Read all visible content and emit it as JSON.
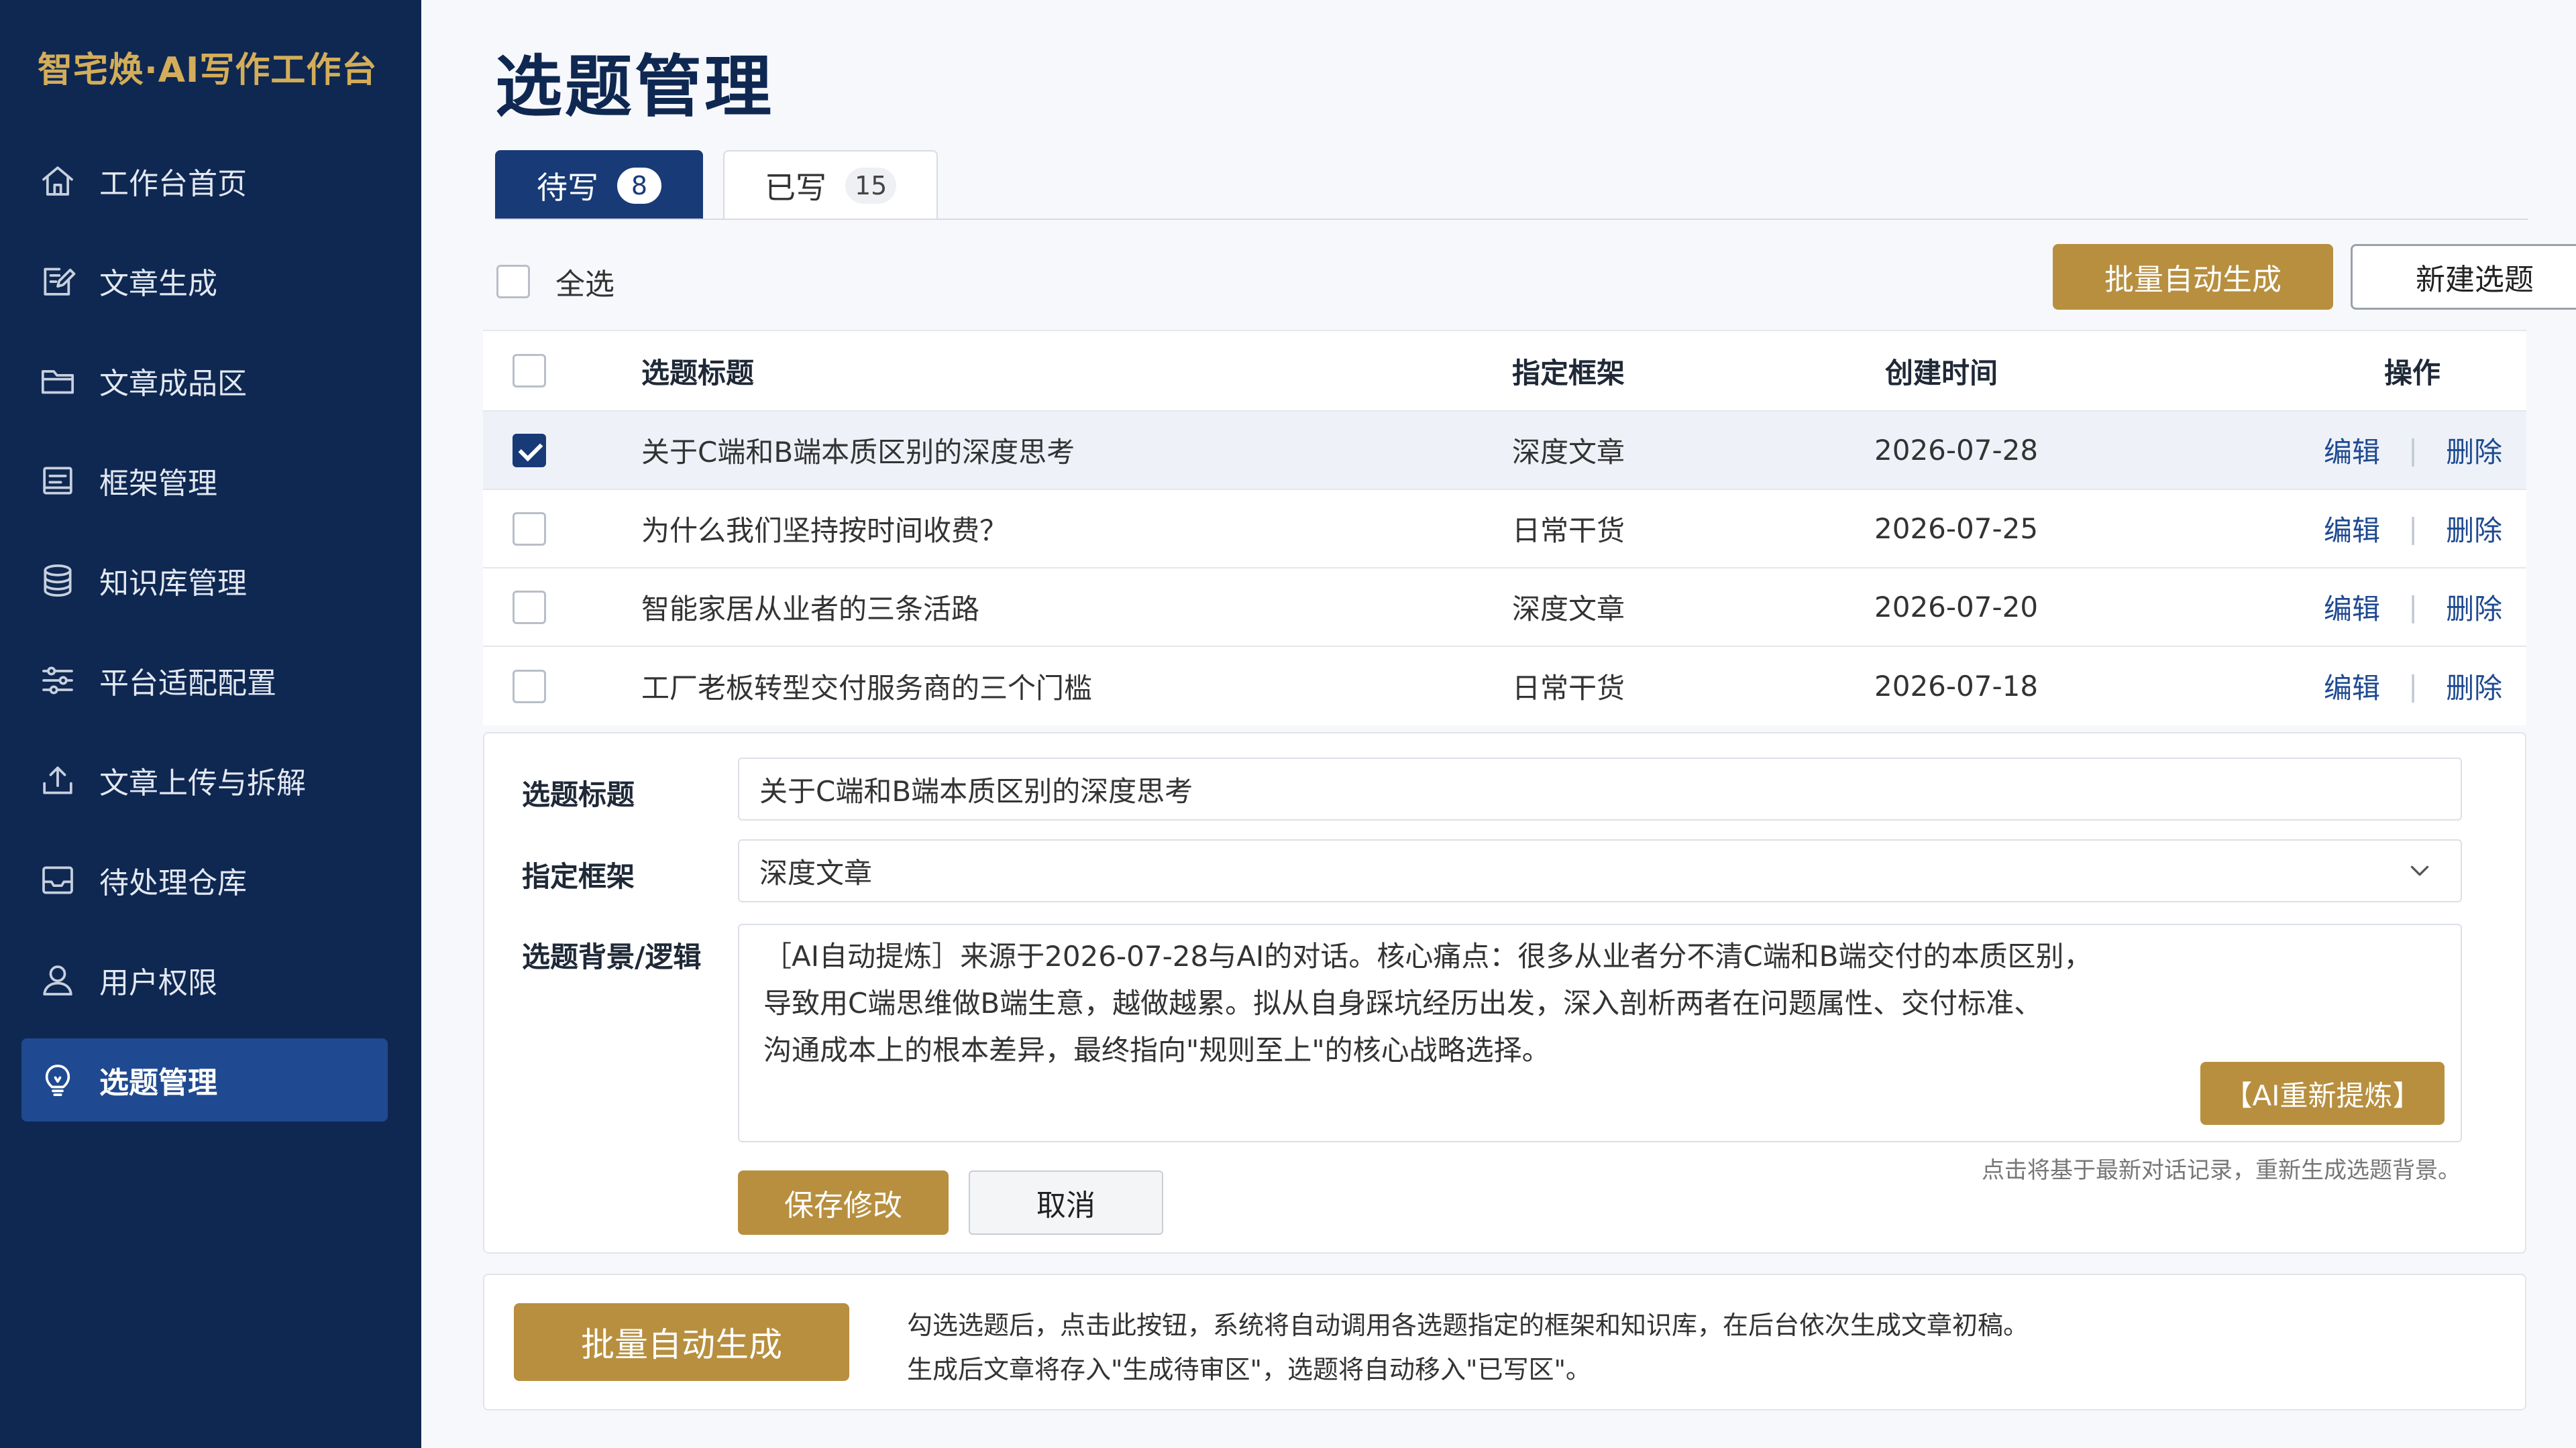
{
  "sidebar": {
    "brand": "智宅焕·AI写作工作台",
    "items": [
      {
        "label": "工作台首页",
        "icon": "home-icon"
      },
      {
        "label": "文章生成",
        "icon": "edit-icon"
      },
      {
        "label": "文章成品区",
        "icon": "folder-icon"
      },
      {
        "label": "框架管理",
        "icon": "frame-icon"
      },
      {
        "label": "知识库管理",
        "icon": "database-icon"
      },
      {
        "label": "平台适配配置",
        "icon": "sliders-icon"
      },
      {
        "label": "文章上传与拆解",
        "icon": "upload-icon"
      },
      {
        "label": "待处理仓库",
        "icon": "inbox-icon"
      },
      {
        "label": "用户权限",
        "icon": "user-icon"
      },
      {
        "label": "选题管理",
        "icon": "lightbulb-icon",
        "active": true
      }
    ]
  },
  "page": {
    "title": "选题管理"
  },
  "tabs": [
    {
      "label": "待写",
      "count": "8",
      "active": true
    },
    {
      "label": "已写",
      "count": "15",
      "active": false
    }
  ],
  "toolbar": {
    "select_all": "全选",
    "batch_generate": "批量自动生成",
    "new_topic": "新建选题"
  },
  "table": {
    "headers": {
      "title": "选题标题",
      "framework": "指定框架",
      "created": "创建时间",
      "actions": "操作"
    },
    "rows": [
      {
        "title": "关于C端和B端本质区别的深度思考",
        "framework": "深度文章",
        "created": "2026-07-28",
        "edit": "编辑",
        "delete": "删除",
        "checked": true
      },
      {
        "title": "为什么我们坚持按时间收费？",
        "framework": "日常干货",
        "created": "2026-07-25",
        "edit": "编辑",
        "delete": "删除",
        "checked": false
      },
      {
        "title": "智能家居从业者的三条活路",
        "framework": "深度文章",
        "created": "2026-07-20",
        "edit": "编辑",
        "delete": "删除",
        "checked": false
      },
      {
        "title": "工厂老板转型交付服务商的三个门槛",
        "framework": "日常干货",
        "created": "2026-07-18",
        "edit": "编辑",
        "delete": "删除",
        "checked": false
      }
    ]
  },
  "edit_form": {
    "title_label": "选题标题",
    "title_value": "关于C端和B端本质区别的深度思考",
    "framework_label": "指定框架",
    "framework_value": "深度文章",
    "background_label": "选题背景/逻辑",
    "background_line1": "［AI自动提炼］来源于2026-07-28与AI的对话。核心痛点：很多从业者分不清C端和B端交付的本质区别，",
    "background_line2": "导致用C端思维做B端生意，越做越累。拟从自身踩坑经历出发，深入剖析两者在问题属性、交付标准、",
    "background_line3": "沟通成本上的根本差异，最终指向\"规则至上\"的核心战略选择。",
    "refine_button": "【AI重新提炼】",
    "refine_hint": "点击将基于最新对话记录，重新生成选题背景。",
    "save_button": "保存修改",
    "cancel_button": "取消"
  },
  "bottom": {
    "batch_button": "批量自动生成",
    "note_line1": "勾选选题后，点击此按钮，系统将自动调用各选题指定的框架和知识库，在后台依次生成文章初稿。",
    "note_line2": "生成后文章将存入\"生成待审区\"，选题将自动移入\"已写区\"。"
  },
  "colors": {
    "sidebar_bg": "#0f2852",
    "brand_gold": "#d3ad59",
    "accent_gold": "#b78f3f",
    "primary_navy": "#183b77",
    "link_blue": "#1f4a91"
  }
}
